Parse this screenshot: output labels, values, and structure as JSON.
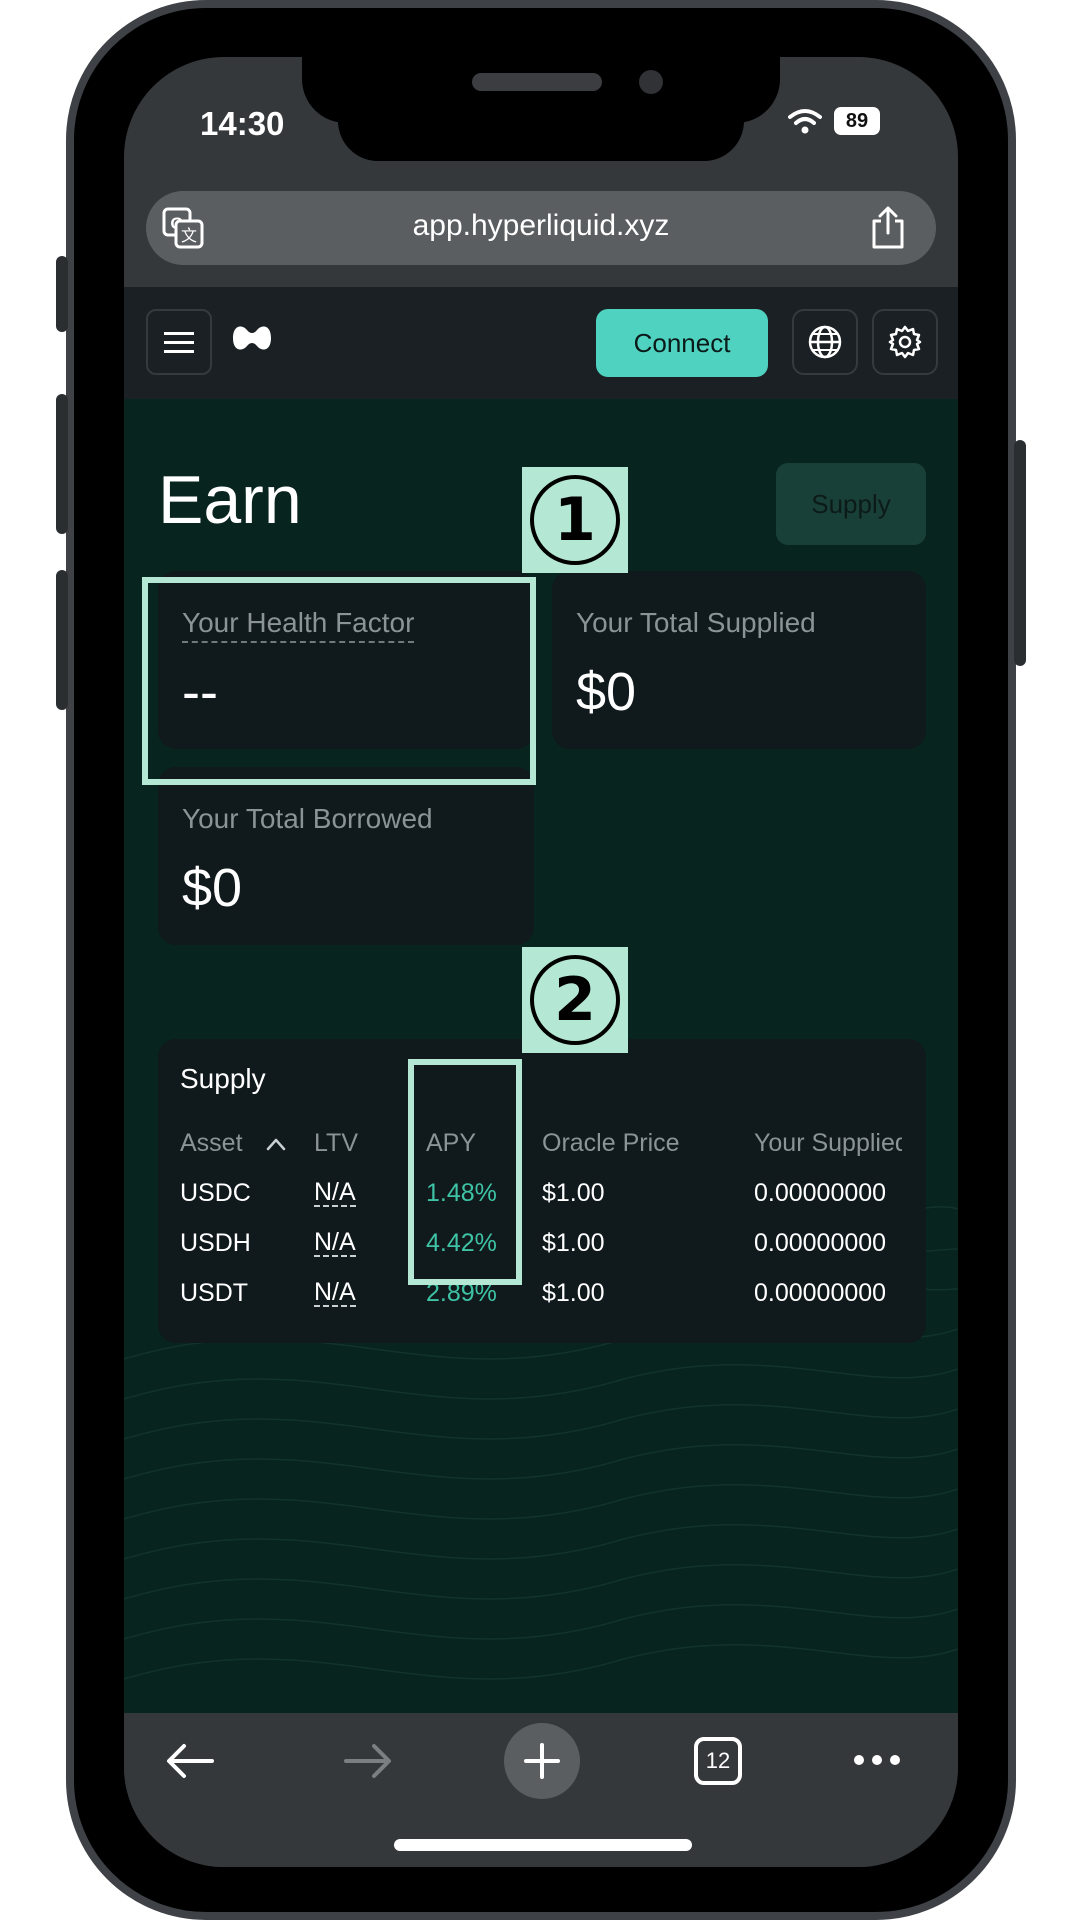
{
  "status_bar": {
    "time": "14:30",
    "battery": "89"
  },
  "browser": {
    "url": "app.hyperliquid.xyz",
    "tabs_count": "12"
  },
  "app_header": {
    "connect_label": "Connect"
  },
  "page": {
    "title": "Earn",
    "supply_button": "Supply",
    "cards": {
      "health_factor": {
        "label": "Your Health Factor",
        "value": "--"
      },
      "total_supplied": {
        "label": "Your Total Supplied",
        "value": "$0"
      },
      "total_borrowed": {
        "label": "Your Total Borrowed",
        "value": "$0"
      }
    },
    "supply_table": {
      "title": "Supply",
      "columns": [
        "Asset",
        "LTV",
        "APY",
        "Oracle Price",
        "Your Supplied"
      ],
      "rows": [
        {
          "asset": "USDC",
          "ltv": "N/A",
          "apy": "1.48%",
          "oracle_price": "$1.00",
          "supplied": "0.00000000"
        },
        {
          "asset": "USDH",
          "ltv": "N/A",
          "apy": "4.42%",
          "oracle_price": "$1.00",
          "supplied": "0.00000000"
        },
        {
          "asset": "USDT",
          "ltv": "N/A",
          "apy": "2.89%",
          "oracle_price": "$1.00",
          "supplied": "0.00000000"
        }
      ]
    }
  },
  "annotations": {
    "step_1": "1",
    "step_2": "2"
  },
  "colors": {
    "accent": "#50d2c1",
    "apy": "#3ec3a5",
    "annotation": "#b5e7d5",
    "page_bg": "#07241f"
  },
  "icons": [
    "translate-icon",
    "share-icon",
    "menu-icon",
    "hyperliquid-logo",
    "globe-icon",
    "gear-icon",
    "back-arrow-icon",
    "forward-arrow-icon",
    "plus-icon",
    "more-icon",
    "wifi-icon",
    "chevron-up-icon"
  ]
}
